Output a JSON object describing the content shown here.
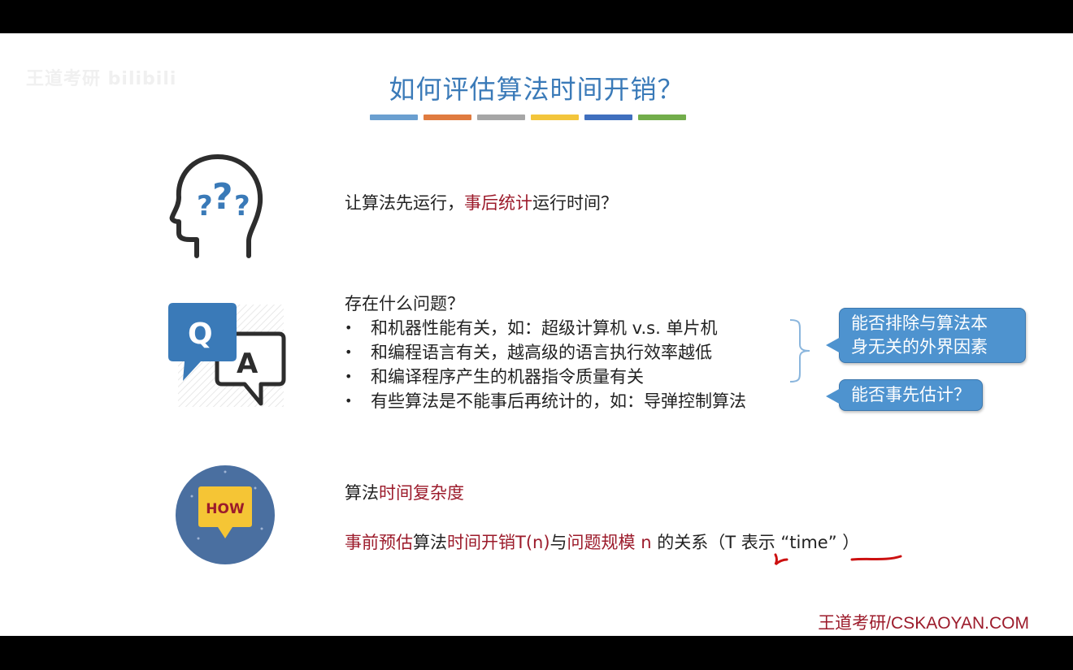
{
  "watermark": "王道考研 bilibili",
  "title": "如何评估算法时间开销？",
  "color_bars": [
    "#6a9fd0",
    "#e07b3f",
    "#a6a6a6",
    "#f3c53b",
    "#3f6fbe",
    "#72ad4b"
  ],
  "section1": {
    "icon": "head-question-icon",
    "text_pre": "让算法先运行，",
    "text_red": "事后统计",
    "text_post": "运行时间？"
  },
  "section2": {
    "icon": "qa-bubbles-icon",
    "heading": "存在什么问题？",
    "bullets": [
      "和机器性能有关，如：超级计算机 v.s. 单片机",
      "和编程语言有关，越高级的语言执行效率越低",
      "和编译程序产生的机器指令质量有关",
      "有些算法是不能事后再统计的，如：导弹控制算法"
    ],
    "callout1": {
      "line1": "能否排除与算法本",
      "line2": "身无关的外界因素"
    },
    "callout2": "能否事先估计？"
  },
  "section3": {
    "icon": "how-badge-icon",
    "how_label": "HOW",
    "line1_pre": "算法",
    "line1_red": "时间复杂度",
    "line2_red1": "事前预估",
    "line2_mid1": "算法",
    "line2_red2": "时间开销T(n)",
    "line2_mid2": "与",
    "line2_red3": "问题规模 n",
    "line2_post": " 的关系（T 表示 “time” ）"
  },
  "footer": "王道考研/CSKAOYAN.COM"
}
